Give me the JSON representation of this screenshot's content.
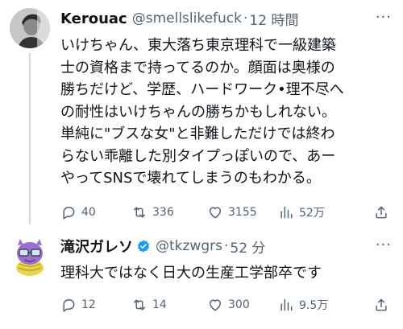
{
  "tweets": [
    {
      "name": "Kerouac",
      "handle": "@smellslikefuck",
      "separator": "·",
      "time": "12 時間",
      "more": "···",
      "lines": [
        "いけちゃん、東大落ち東京理科で一級建築",
        "士の資格まで持ってるのか。顔面は奥様の",
        "勝ちだけど、学歴、ハードワーク•理不尽へ",
        "の耐性はいけちゃんの勝ちかもしれない。",
        "単純に\"ブスな女\"と非難しただけでは終わ",
        "らない乖離した別タイプっぽいので、あー",
        "やってSNSで壊れてしまうのもわかる。"
      ],
      "replies": "40",
      "retweets": "336",
      "likes": "3155",
      "views": "52万",
      "verified": false
    },
    {
      "name": "滝沢ガレソ",
      "handle": "@tkzwgrs",
      "separator": "·",
      "time": "52 分",
      "more": "···",
      "lines": [
        "理科大ではなく日大の生産工学部卒です"
      ],
      "replies": "12",
      "retweets": "14",
      "likes": "300",
      "views": "9.5万",
      "verified": true
    }
  ],
  "colors": {
    "text": "#0f1419",
    "muted": "#536471",
    "verified": "#1d9bf0",
    "line": "#cfd9de"
  },
  "icons": [
    "reply-icon",
    "retweet-icon",
    "like-icon",
    "views-icon",
    "share-icon",
    "more-icon",
    "verified-badge-icon"
  ]
}
